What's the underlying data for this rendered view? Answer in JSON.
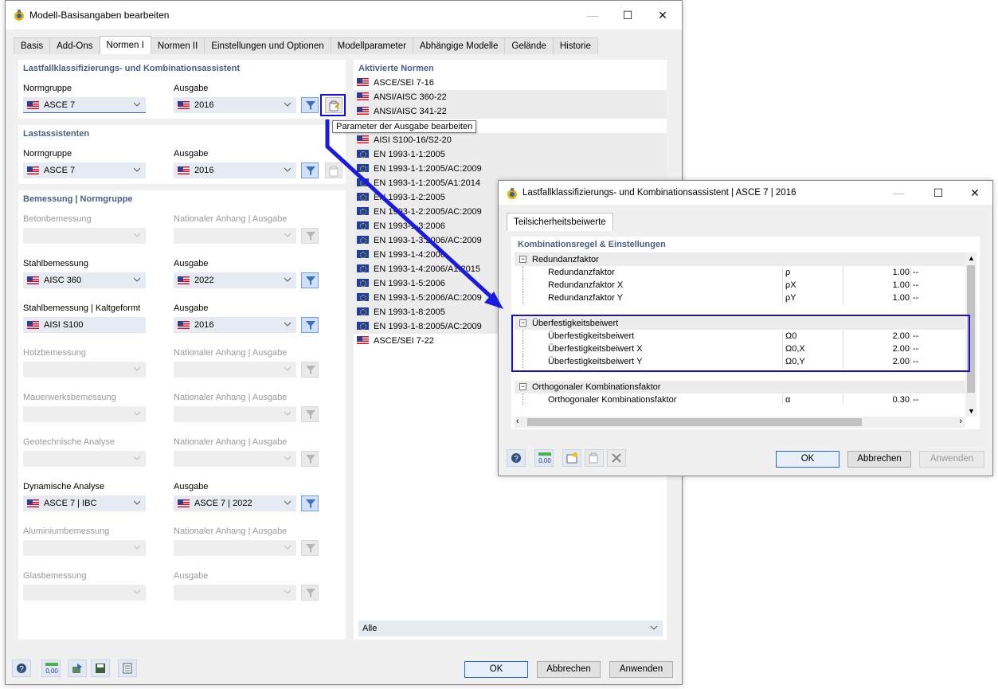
{
  "main_window": {
    "title": "Modell-Basisangaben bearbeiten",
    "tabs": [
      "Basis",
      "Add-Ons",
      "Normen I",
      "Normen II",
      "Einstellungen und Optionen",
      "Modellparameter",
      "Abhängige Modelle",
      "Gelände",
      "Historie"
    ],
    "active_tab": "Normen I",
    "lastfall_section": {
      "title": "Lastfallklassifizierungs- und Kombinationsassistent",
      "normgruppe_label": "Normgruppe",
      "normgruppe_value": "ASCE 7",
      "ausgabe_label": "Ausgabe",
      "ausgabe_value": "2016"
    },
    "lastassist_section": {
      "title": "Lastassistenten",
      "normgruppe_label": "Normgruppe",
      "normgruppe_value": "ASCE 7",
      "ausgabe_label": "Ausgabe",
      "ausgabe_value": "2016"
    },
    "bemessung_section": {
      "title": "Bemessung | Normgruppe",
      "rows": [
        {
          "left_label": "Betonbemessung",
          "right_label": "Nationaler Anhang | Ausgabe",
          "left_value": "",
          "right_value": ""
        },
        {
          "left_label": "Stahlbemessung",
          "right_label": "Ausgabe",
          "left_value": "AISC 360",
          "right_value": "2022"
        },
        {
          "left_label": "Stahlbemessung | Kaltgeformt",
          "right_label": "Ausgabe",
          "left_value": "AISI S100",
          "right_value": "2016"
        },
        {
          "left_label": "Holzbemessung",
          "right_label": "Nationaler Anhang | Ausgabe",
          "left_value": "",
          "right_value": ""
        },
        {
          "left_label": "Mauerwerksbemessung",
          "right_label": "Nationaler Anhang | Ausgabe",
          "left_value": "",
          "right_value": ""
        },
        {
          "left_label": "Geotechnische Analyse",
          "right_label": "Nationaler Anhang | Ausgabe",
          "left_value": "",
          "right_value": ""
        },
        {
          "left_label": "Dynamische Analyse",
          "right_label": "Ausgabe",
          "left_value": "ASCE 7 | IBC",
          "right_value": "ASCE 7 | 2022"
        },
        {
          "left_label": "Aluminiumbemessung",
          "right_label": "Nationaler Anhang | Ausgabe",
          "left_value": "",
          "right_value": ""
        },
        {
          "left_label": "Glasbemessung",
          "right_label": "Ausgabe",
          "left_value": "",
          "right_value": ""
        }
      ]
    },
    "aktivierte_normen": {
      "title": "Aktivierte Normen",
      "items": [
        {
          "flag": "us",
          "text": "ASCE/SEI 7-16"
        },
        {
          "flag": "us",
          "text": "ANSI/AISC 360-22"
        },
        {
          "flag": "us",
          "text": "ANSI/AISC 341-22"
        },
        {
          "flag": "us",
          "text": ""
        },
        {
          "flag": "us",
          "text": "AISI S100-16/S2-20"
        },
        {
          "flag": "eu",
          "text": "EN 1993-1-1:2005"
        },
        {
          "flag": "eu",
          "text": "EN 1993-1-1:2005/AC:2009"
        },
        {
          "flag": "eu",
          "text": "EN 1993-1-1:2005/A1:2014"
        },
        {
          "flag": "eu",
          "text": "EN 1993-1-2:2005"
        },
        {
          "flag": "eu",
          "text": "EN 1993-1-2:2005/AC:2009"
        },
        {
          "flag": "eu",
          "text": "EN 1993-1-3:2006"
        },
        {
          "flag": "eu",
          "text": "EN 1993-1-3:2006/AC:2009"
        },
        {
          "flag": "eu",
          "text": "EN 1993-1-4:2006"
        },
        {
          "flag": "eu",
          "text": "EN 1993-1-4:2006/A1:2015"
        },
        {
          "flag": "eu",
          "text": "EN 1993-1-5:2006"
        },
        {
          "flag": "eu",
          "text": "EN 1993-1-5:2006/AC:2009"
        },
        {
          "flag": "eu",
          "text": "EN 1993-1-8:2005"
        },
        {
          "flag": "eu",
          "text": "EN 1993-1-8:2005/AC:2009"
        },
        {
          "flag": "us",
          "text": "ASCE/SEI 7-22"
        }
      ],
      "filter_value": "Alle"
    },
    "tooltip": "Parameter der Ausgabe bearbeiten",
    "buttons": {
      "ok": "OK",
      "cancel": "Abbrechen",
      "apply": "Anwenden"
    }
  },
  "sub_window": {
    "title": "Lastfallklassifizierungs- und Kombinationsassistent | ASCE 7 | 2016",
    "tab": "Teilsicherheitsbeiwerte",
    "section_title": "Kombinationsregel & Einstellungen",
    "groups": [
      {
        "name": "Redundanzfaktor",
        "rows": [
          {
            "name": "Redundanzfaktor",
            "symbol": "ρ",
            "value": "1.00",
            "unit": "--"
          },
          {
            "name": "Redundanzfaktor X",
            "symbol": "ρX",
            "value": "1.00",
            "unit": "--"
          },
          {
            "name": "Redundanzfaktor Y",
            "symbol": "ρY",
            "value": "1.00",
            "unit": "--"
          }
        ]
      },
      {
        "name": "Überfestigkeitsbeiwert",
        "rows": [
          {
            "name": "Überfestigkeitsbeiwert",
            "symbol": "Ω0",
            "value": "2.00",
            "unit": "--"
          },
          {
            "name": "Überfestigkeitsbeiwert X",
            "symbol": "Ω0,X",
            "value": "2.00",
            "unit": "--"
          },
          {
            "name": "Überfestigkeitsbeiwert Y",
            "symbol": "Ω0,Y",
            "value": "2.00",
            "unit": "--"
          }
        ]
      },
      {
        "name": "Orthogonaler Kombinationsfaktor",
        "rows": [
          {
            "name": "Orthogonaler Kombinationsfaktor",
            "symbol": "α",
            "value": "0.30",
            "unit": "--"
          }
        ]
      }
    ],
    "buttons": {
      "ok": "OK",
      "cancel": "Abbrechen",
      "apply": "Anwenden"
    }
  },
  "colors": {
    "highlight": "#1010d8",
    "section_title": "#4a5f85",
    "arrow": "#1a1ae0"
  }
}
